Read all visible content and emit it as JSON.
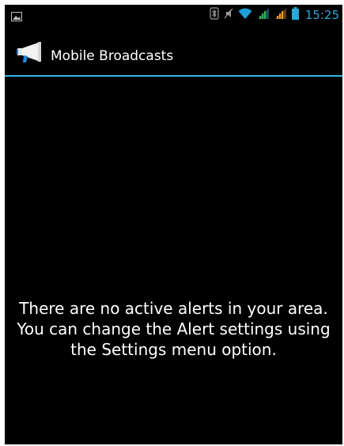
{
  "status_bar": {
    "time": "15:25",
    "icons": [
      "image-notification-icon",
      "bluetooth-icon",
      "mute-icon",
      "wifi-icon",
      "signal-icon",
      "signal-icon",
      "battery-icon"
    ]
  },
  "action_bar": {
    "title": "Mobile Broadcasts",
    "icon": "megaphone-icon"
  },
  "main": {
    "empty_message": "There are no active alerts in your area. You can change the Alert settings using the Settings menu option."
  },
  "colors": {
    "accent": "#33b5e5",
    "background": "#000000",
    "text": "#ffffff"
  }
}
